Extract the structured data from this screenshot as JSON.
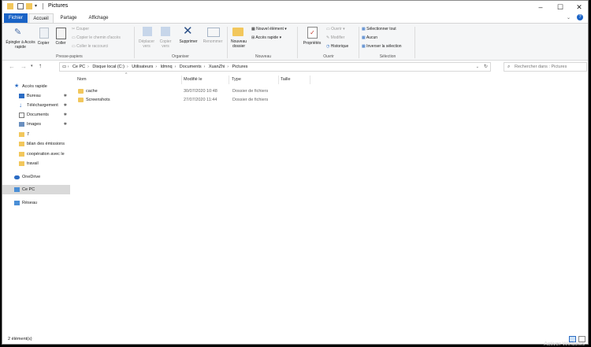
{
  "window": {
    "title": "Pictures"
  },
  "ribbon_tabs": [
    "Fichier",
    "Accueil",
    "Partage",
    "Affichage"
  ],
  "ribbon": {
    "pin_label": "Épingler à Accès rapide",
    "copy_label": "Copier",
    "paste_label": "Coller",
    "cut_label": "Couper",
    "copy_path_label": "Copier le chemin d'accès",
    "paste_shortcut_label": "Coller le raccourci",
    "clipboard_group": "Presse-papiers",
    "move_label": "Déplacer vers",
    "copy_to_label": "Copier vers",
    "delete_label": "Supprimer",
    "rename_label": "Renommer",
    "organize_group": "Organiser",
    "new_folder_label": "Nouveau dossier",
    "new_item_label": "Nouvel élément",
    "easy_access_label": "Accès rapide",
    "new_group": "Nouveau",
    "properties_label": "Propriétés",
    "open_label": "Ouvrir",
    "edit_label": "Modifier",
    "history_label": "Historique",
    "open_group": "Ouvrir",
    "select_all_label": "Sélectionner tout",
    "select_none_label": "Aucun",
    "invert_label": "Inverser la sélection",
    "select_group": "Sélection"
  },
  "breadcrumb": [
    "Ce PC",
    "Disque local (C:)",
    "Utilisateurs",
    "ldmnq",
    "Documents",
    "XuanZhi",
    "Pictures"
  ],
  "search_placeholder": "Rechercher dans : Pictures",
  "nav": [
    {
      "label": "Accès rapide",
      "pinned": false
    },
    {
      "label": "Bureau",
      "pinned": true
    },
    {
      "label": "Téléchargement",
      "pinned": true
    },
    {
      "label": "Documents",
      "pinned": true
    },
    {
      "label": "Images",
      "pinned": true
    },
    {
      "label": "7",
      "pinned": false
    },
    {
      "label": "bilan des émissions",
      "pinned": false
    },
    {
      "label": "coopération avec le",
      "pinned": false
    },
    {
      "label": "travail",
      "pinned": false
    },
    {
      "label": "OneDrive",
      "pinned": false
    },
    {
      "label": "Ce PC",
      "pinned": false
    },
    {
      "label": "Réseau",
      "pinned": false
    }
  ],
  "pin_glyph": "✱",
  "columns": [
    "Nom",
    "Modifié le",
    "Type",
    "Taille"
  ],
  "files": [
    {
      "name": "cache",
      "modified": "30/07/2020 10:48",
      "type": "Dossier de fichiers",
      "size": ""
    },
    {
      "name": "Screenshots",
      "modified": "27/07/2020 11:44",
      "type": "Dossier de fichiers",
      "size": ""
    }
  ],
  "status": "2 élément(s)",
  "watermark": "Activer Windows"
}
